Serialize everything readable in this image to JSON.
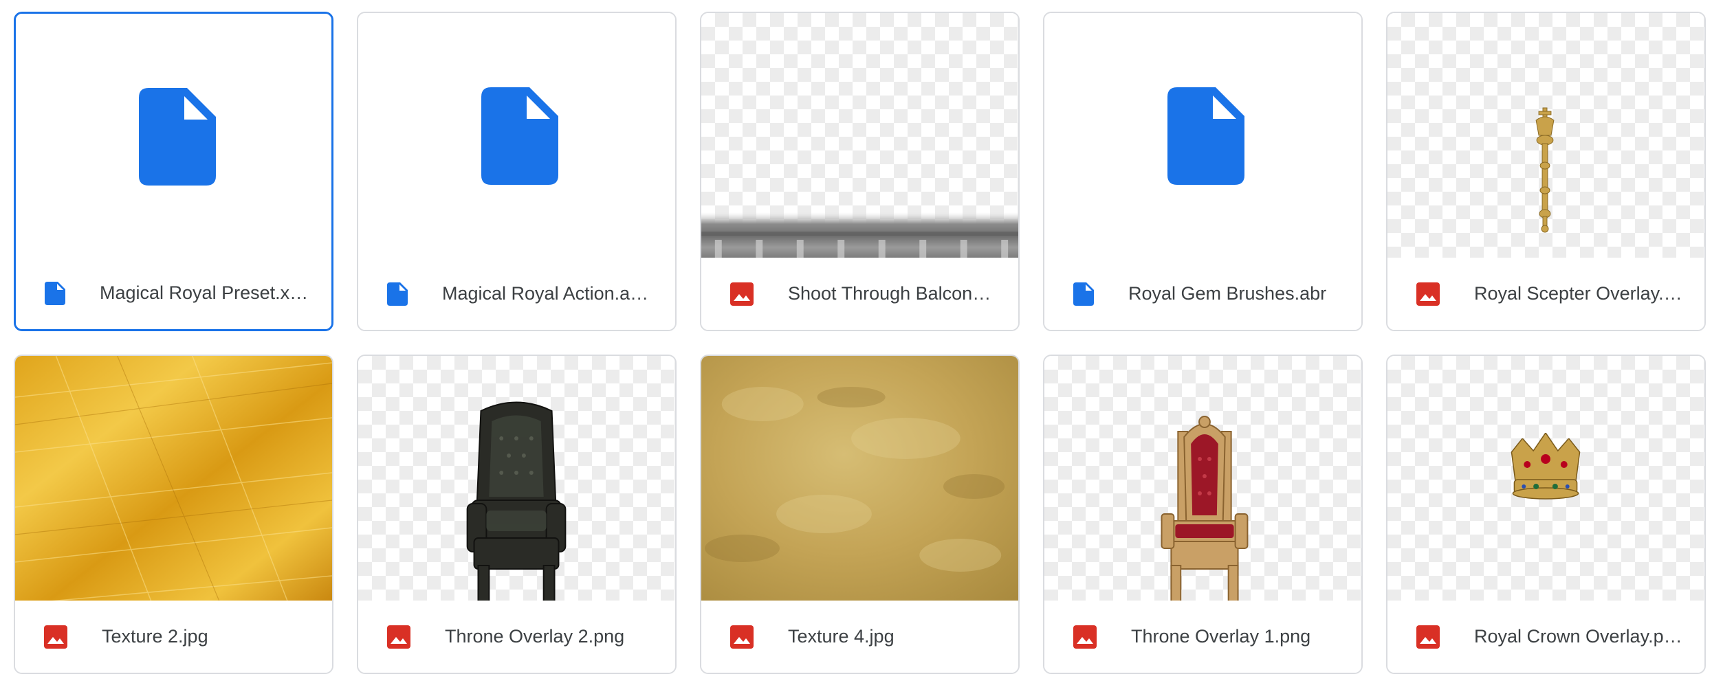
{
  "files": [
    {
      "name": "Magical Royal Preset.xmp",
      "display_name": "Magical Royal Preset.x…",
      "type_icon": "document-icon",
      "preview": "document-icon",
      "selected": true
    },
    {
      "name": "Magical Royal Action.atn",
      "display_name": "Magical Royal Action.a…",
      "type_icon": "document-icon",
      "preview": "document-icon"
    },
    {
      "name": "Shoot Through Balcony",
      "display_name": "Shoot Through Balcon…",
      "type_icon": "image-icon",
      "preview": "balcony-railing-overlay"
    },
    {
      "name": "Royal Gem Brushes.abr",
      "display_name": "Royal Gem Brushes.abr",
      "type_icon": "document-icon",
      "preview": "document-icon"
    },
    {
      "name": "Royal Scepter Overlay.png",
      "display_name": "Royal Scepter Overlay.…",
      "type_icon": "image-icon",
      "preview": "gold-scepter"
    },
    {
      "name": "Texture 2.jpg",
      "display_name": "Texture 2.jpg",
      "type_icon": "image-icon",
      "preview": "gold-foil-texture"
    },
    {
      "name": "Throne Overlay 2.png",
      "display_name": "Throne Overlay 2.png",
      "type_icon": "image-icon",
      "preview": "dark-leather-throne"
    },
    {
      "name": "Texture 4.jpg",
      "display_name": "Texture 4.jpg",
      "type_icon": "image-icon",
      "preview": "gold-leaf-texture"
    },
    {
      "name": "Throne Overlay 1.png",
      "display_name": "Throne Overlay 1.png",
      "type_icon": "image-icon",
      "preview": "red-gold-throne"
    },
    {
      "name": "Royal Crown Overlay.png",
      "display_name": "Royal Crown Overlay.p…",
      "type_icon": "image-icon",
      "preview": "jeweled-crown"
    }
  ],
  "colors": {
    "doc_blue": "#1a73e8",
    "image_red": "#d93025",
    "selected_border": "#1a73e8",
    "card_border": "#dadce0",
    "text": "#3c4043"
  }
}
